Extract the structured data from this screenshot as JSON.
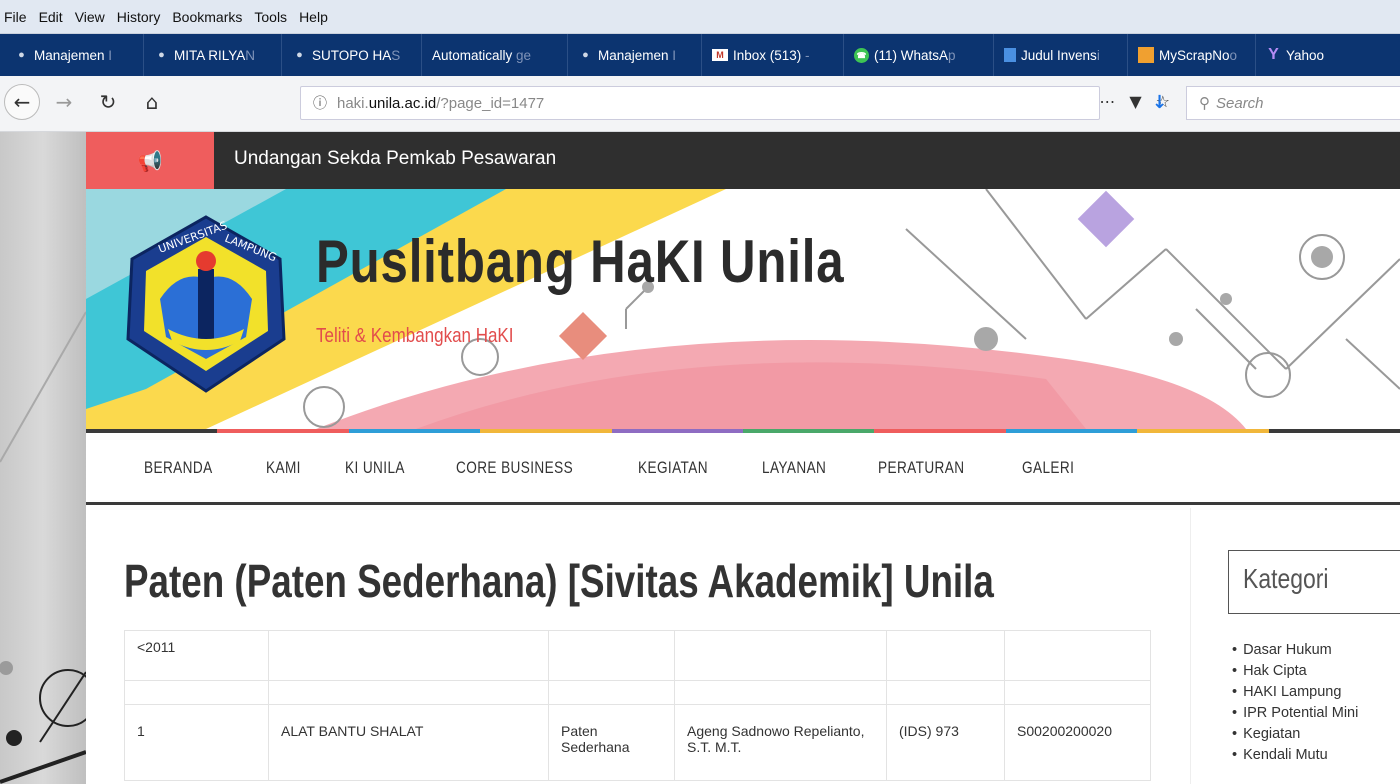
{
  "menubar": {
    "items": [
      "File",
      "Edit",
      "View",
      "History",
      "Bookmarks",
      "Tools",
      "Help"
    ]
  },
  "bookmarks": {
    "items": [
      {
        "label": "Manajemen",
        "fade": " I",
        "icon": "user-icon"
      },
      {
        "label": "MITA RILYA",
        "fade": "N",
        "icon": "user-icon"
      },
      {
        "label": "SUTOPO HA",
        "fade": "S",
        "icon": "user-icon"
      },
      {
        "label": "Automatically",
        "fade": " ge",
        "icon": "none"
      },
      {
        "label": "Manajemen",
        "fade": " I",
        "icon": "user-icon"
      },
      {
        "label": "Inbox (513)",
        "fade": " -",
        "icon": "mail-icon"
      },
      {
        "label": "(11) WhatsA",
        "fade": "p",
        "icon": "whatsapp-icon"
      },
      {
        "label": "Judul Invens",
        "fade": "i",
        "icon": "doc-icon"
      },
      {
        "label": "MyScrapNo",
        "fade": "o",
        "icon": "scrap-icon"
      },
      {
        "label": "Yahoo",
        "fade": "",
        "icon": "yahoo-icon"
      }
    ]
  },
  "navbar": {
    "url_prefix": "haki.",
    "url_domain": "unila.ac.id",
    "url_suffix": "/?page_id=1477",
    "search_placeholder": "Search"
  },
  "ticker": {
    "text": "Undangan Sekda Pemkab Pesawaran"
  },
  "header": {
    "site_title": "Puslitbang HaKI Unila",
    "tagline": "Teliti & Kembangkan HaKI",
    "logo_text": "UNIVERSITAS LAMPUNG"
  },
  "mainnav": {
    "items": [
      "BERANDA",
      "KAMI",
      "KI UNILA",
      "CORE BUSINESS",
      "KEGIATAN",
      "LAYANAN",
      "PERATURAN",
      "GALERI"
    ]
  },
  "content": {
    "page_title": "Paten (Paten Sederhana) [Sivitas Akademik] Unila",
    "table_rows": [
      [
        "<2011",
        "",
        "",
        "",
        "",
        ""
      ],
      [
        "",
        "",
        "",
        "",
        "",
        ""
      ],
      [
        "1",
        "ALAT BANTU SHALAT",
        "Paten Sederhana",
        "Ageng Sadnowo Repelianto, S.T. M.T.",
        "(IDS) 973",
        "S00200200020"
      ]
    ]
  },
  "sidebar": {
    "kategori_title": "Kategori",
    "categories": [
      "Dasar Hukum",
      "Hak Cipta",
      "HAKI Lampung",
      "IPR Potential Mini",
      "Kegiatan",
      "Kendali Mutu"
    ]
  },
  "colors": {
    "accent_red": "#ef5d5d",
    "bookmark_bar": "#0c3470",
    "ticker_bg": "#2f2f2f"
  }
}
